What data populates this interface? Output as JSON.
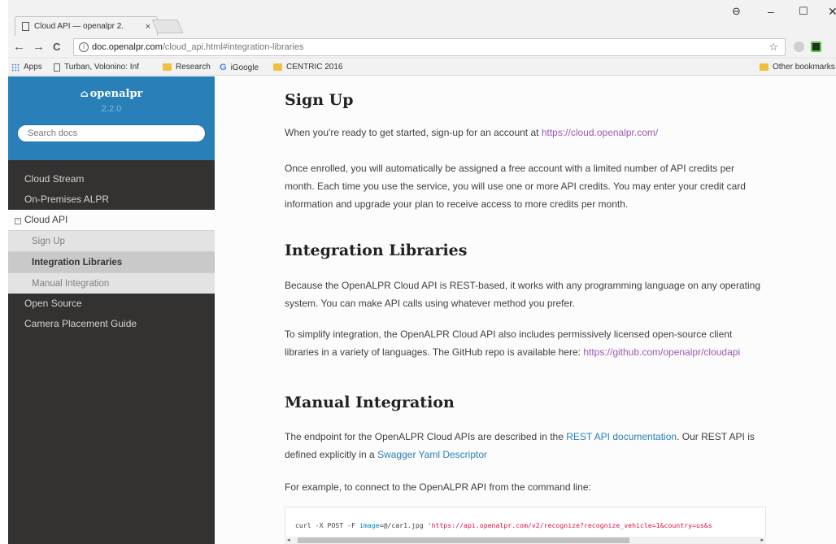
{
  "browser": {
    "tab_title": "Cloud API — openalpr 2.",
    "tab_close": "×",
    "url_host": "doc.openalpr.com",
    "url_path": "/cloud_api.html#integration-libraries",
    "bookmarks": [
      "Apps",
      "Turban, Volonino: Inf",
      "Research",
      "iGoogle",
      "CENTRIC 2016"
    ],
    "other_bookmarks": "Other bookmarks",
    "window_controls": {
      "user": "⊖",
      "minimize": "–",
      "maximize": "☐",
      "close": "✕"
    },
    "nav": {
      "back": "←",
      "forward": "→",
      "reload": "C",
      "star": "☆"
    },
    "colors": {
      "ext_grey": "#cfcfcf",
      "ext_dark": "#2b2b2b",
      "ext_green": "#4cd137"
    }
  },
  "sidebar": {
    "project": "openalpr",
    "home_icon": "home-icon",
    "version": "2.2.0",
    "search_placeholder": "Search docs",
    "items": [
      {
        "label": "Cloud Stream"
      },
      {
        "label": "On-Premises ALPR"
      },
      {
        "label": "Cloud API",
        "expanded": true
      },
      {
        "label": "Sign Up"
      },
      {
        "label": "Integration Libraries",
        "active": true
      },
      {
        "label": "Manual Integration"
      },
      {
        "label": "Open Source"
      },
      {
        "label": "Camera Placement Guide"
      }
    ],
    "expand_icon": "⊟",
    "colors": {
      "header": "#2980b9",
      "nav_bg": "#343131"
    }
  },
  "content": {
    "signup_heading": "Sign Up",
    "signup_p1_text": "When you're ready to get started, sign-up for an account at ",
    "signup_p1_link": "https://cloud.openalpr.com/",
    "signup_p2": "Once enrolled, you will automatically be assigned a free account with a limited number of API credits per month. Each time you use the service, you will use one or more API credits. You may enter your credit card information and upgrade your plan to receive access to more credits per month.",
    "integration_heading": "Integration Libraries",
    "integration_p1": "Because the OpenALPR Cloud API is REST-based, it works with any programming language on any operating system. You can make API calls using whatever method you prefer.",
    "integration_p2_text": "To simplify integration, the OpenALPR Cloud API also includes permissively licensed open-source client libraries in a variety of languages. The GitHub repo is available here: ",
    "integration_p2_link": "https://github.com/openalpr/cloudapi",
    "manual_heading": "Manual Integration",
    "manual_p1_a": "The endpoint for the OpenALPR Cloud APIs are described in the ",
    "manual_p1_link1": "REST API documentation",
    "manual_p1_b": ". Our REST API is defined explicitly in a ",
    "manual_p1_link2": "Swagger Yaml Descriptor",
    "manual_p2": "For example, to connect to the OpenALPR API from the command line:",
    "code_cmd": "curl -X POST -F ",
    "code_kw": "image",
    "code_mid": "=@/car1.jpg ",
    "code_str": "'https://api.openalpr.com/v2/recognize?recognize_vehicle=1&country=us&s",
    "scroll_left": "◂",
    "scroll_right": "▸",
    "colors": {
      "link": "#2980b9",
      "visited": "#9b59b6",
      "code_string": "#dd1144"
    }
  }
}
